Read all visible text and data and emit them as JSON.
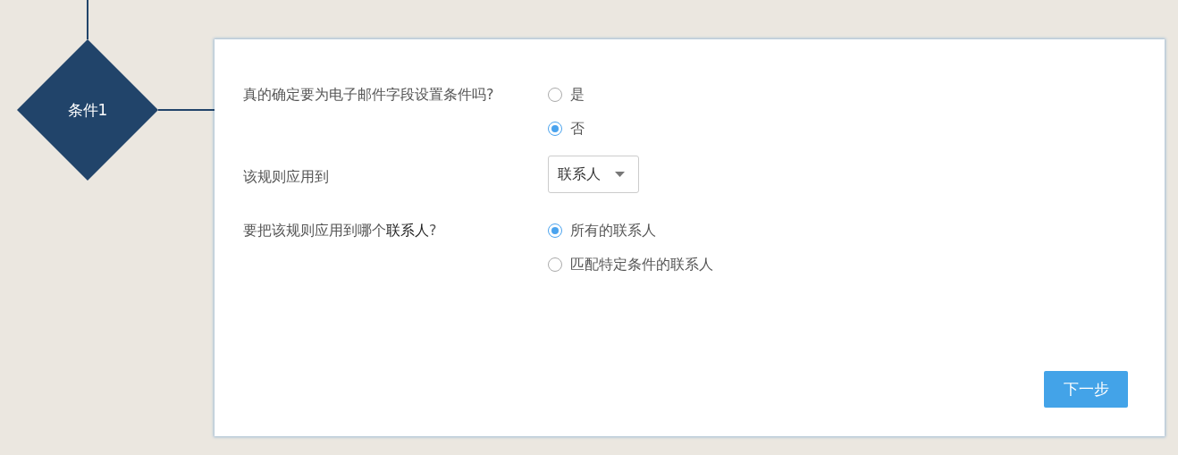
{
  "flow_node": {
    "label": "条件1"
  },
  "questions": [
    {
      "kind": "radio",
      "label": "真的确定要为电子邮件字段设置条件吗?",
      "options": [
        {
          "label": "是",
          "selected": false
        },
        {
          "label": "否",
          "selected": true
        }
      ]
    },
    {
      "kind": "select",
      "label": "该规则应用到",
      "value": "联系人"
    },
    {
      "kind": "radio",
      "label": "要把该规则应用到哪个**联系人**?",
      "options": [
        {
          "label": "所有的联系人",
          "selected": true
        },
        {
          "label": "匹配特定条件的联系人",
          "selected": false
        }
      ]
    }
  ],
  "next_button": "下一步"
}
